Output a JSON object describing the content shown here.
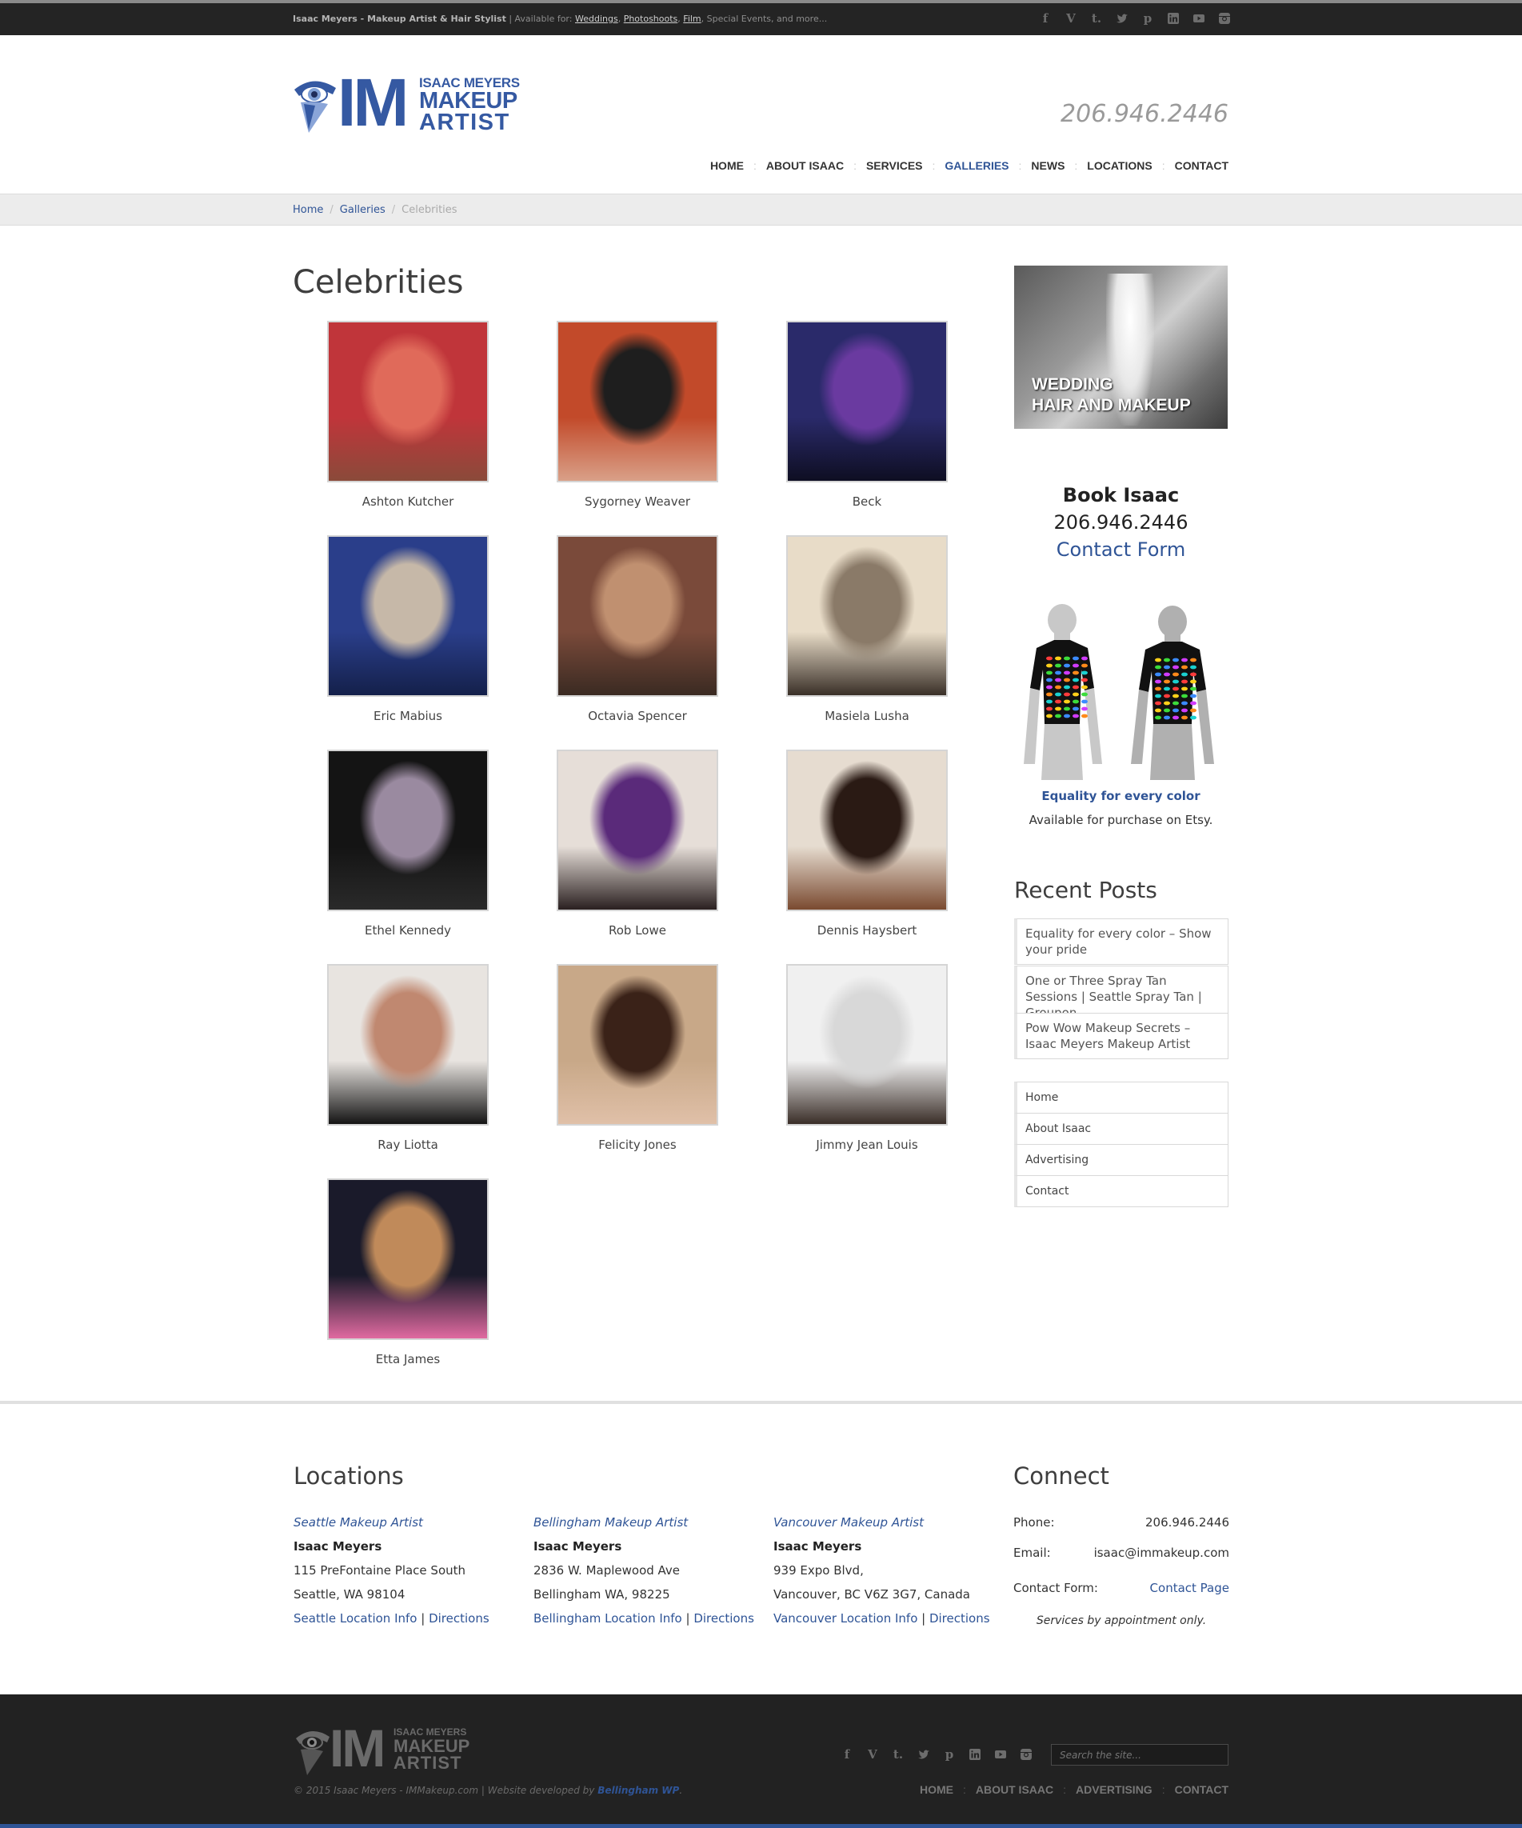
{
  "topbar": {
    "brand": "Isaac Meyers - Makeup Artist & Hair Stylist",
    "available_prefix": "| Available for:",
    "available_links": [
      "Weddings",
      "Photoshoots",
      "Film"
    ],
    "available_suffix": "Special Events, and more...",
    "social_icons": [
      "facebook-icon",
      "vimeo-icon",
      "tumblr-icon",
      "twitter-icon",
      "pinterest-icon",
      "linkedin-icon",
      "youtube-icon",
      "instagram-icon"
    ]
  },
  "header": {
    "logo": {
      "mark": "IM",
      "line1": "ISAAC MEYERS",
      "line2": "MAKEUP",
      "line3": "ARTIST"
    },
    "phone": "206.946.2446",
    "nav": [
      "HOME",
      "ABOUT ISAAC",
      "SERVICES",
      "GALLERIES",
      "NEWS",
      "LOCATIONS",
      "CONTACT"
    ],
    "nav_active": "GALLERIES"
  },
  "breadcrumb": {
    "home": "Home",
    "galleries": "Galleries",
    "current": "Celebrities"
  },
  "page": {
    "title": "Celebrities",
    "gallery": [
      {
        "name": "Ashton Kutcher",
        "tone": [
          "#c0353a",
          "#e06a5a",
          "#8a4a3a"
        ]
      },
      {
        "name": "Sygorney Weaver",
        "tone": [
          "#c24a2a",
          "#1e1e1e",
          "#d9a088"
        ]
      },
      {
        "name": "Beck",
        "tone": [
          "#2a2a6a",
          "#6a3aa0",
          "#0e0e22"
        ]
      },
      {
        "name": "Eric Mabius",
        "tone": [
          "#2a3e8a",
          "#c6b8a8",
          "#14204a"
        ]
      },
      {
        "name": "Octavia Spencer",
        "tone": [
          "#7a4a3a",
          "#c09070",
          "#3a2a22"
        ]
      },
      {
        "name": "Masiela Lusha",
        "tone": [
          "#e8dcc8",
          "#8a7a68",
          "#3a3028"
        ]
      },
      {
        "name": "Ethel Kennedy",
        "tone": [
          "#141414",
          "#9a8aa0",
          "#2a2a2a"
        ]
      },
      {
        "name": "Rob Lowe",
        "tone": [
          "#e6ded8",
          "#5a2a7a",
          "#2a2020"
        ]
      },
      {
        "name": "Dennis Haysbert",
        "tone": [
          "#e6dcd0",
          "#2a1a14",
          "#7a4a30"
        ]
      },
      {
        "name": "Ray Liotta",
        "tone": [
          "#e8e4e0",
          "#c08870",
          "#141414"
        ]
      },
      {
        "name": "Felicity Jones",
        "tone": [
          "#c8a888",
          "#3a2218",
          "#e0c0a8"
        ]
      },
      {
        "name": "Jimmy Jean Louis",
        "tone": [
          "#f0f0f0",
          "#d8d8d8",
          "#3a2e28"
        ]
      },
      {
        "name": "Etta James",
        "tone": [
          "#1a1a2a",
          "#c08a5a",
          "#e06aa0"
        ]
      }
    ]
  },
  "sidebar": {
    "banner_line1": "WEDDING",
    "banner_line2": "HAIR AND MAKEUP",
    "book_title": "Book Isaac",
    "book_phone": "206.946.2446",
    "book_link": "Contact Form",
    "shirt_title": "Equality for every color",
    "shirt_text": "Available for purchase on Etsy.",
    "recent_title": "Recent Posts",
    "recent_posts": [
      "Equality for every color – Show your pride",
      "One or Three Spray Tan Sessions | Seattle Spray Tan | Groupon",
      "Pow Wow Makeup Secrets – Isaac Meyers Makeup Artist"
    ],
    "links": [
      "Home",
      "About Isaac",
      "Advertising",
      "Contact"
    ]
  },
  "footer": {
    "locations_title": "Locations",
    "locations": [
      {
        "label": "Seattle Makeup Artist",
        "name": "Isaac Meyers",
        "address1": "115 PreFontaine Place South",
        "address2": "Seattle, WA 98104",
        "info": "Seattle Location Info",
        "directions": "Directions"
      },
      {
        "label": "Bellingham Makeup Artist",
        "name": "Isaac Meyers",
        "address1": "2836 W. Maplewood Ave",
        "address2": "Bellingham WA, 98225",
        "info": "Bellingham Location Info",
        "directions": "Directions"
      },
      {
        "label": "Vancouver Makeup Artist",
        "name": "Isaac Meyers",
        "address1": "939 Expo Blvd,",
        "address2": "Vancouver, BC V6Z 3G7, Canada",
        "info": "Vancouver Location Info",
        "directions": "Directions"
      }
    ],
    "connect_title": "Connect",
    "phone_label": "Phone:",
    "phone_value": "206.946.2446",
    "email_label": "Email:",
    "email_value": "isaac@immakeup.com",
    "form_label": "Contact Form:",
    "form_value": "Contact Page",
    "note": "Services by appointment only."
  },
  "bottom": {
    "copyright": "© 2015 Isaac Meyers - IMMakeup.com | Website developed by",
    "developer": "Bellingham WP",
    "search_placeholder": "Search the site...",
    "nav": [
      "HOME",
      "ABOUT ISAAC",
      "ADVERTISING",
      "CONTACT"
    ]
  },
  "colors": {
    "accent": "#2f5496",
    "topbar": "#242424",
    "footer": "#222222"
  }
}
